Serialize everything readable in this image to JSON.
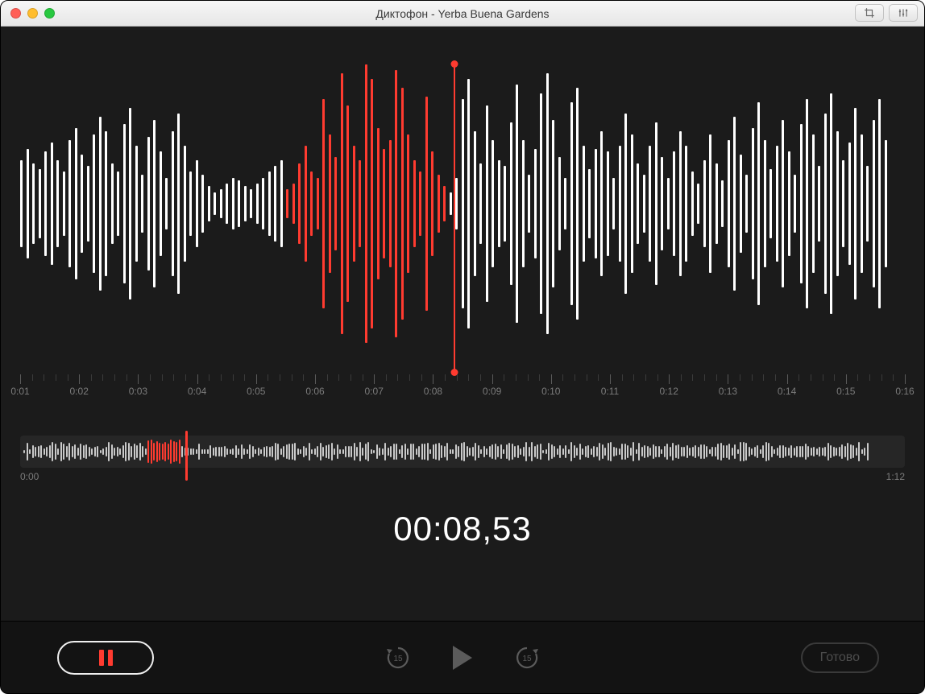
{
  "window": {
    "title": "Диктофон - Yerba Buena Gardens"
  },
  "toolbar": {
    "crop_icon": "crop-icon",
    "tune_icon": "equalizer-icon"
  },
  "timeline": {
    "labels": [
      "0:01",
      "0:02",
      "0:03",
      "0:04",
      "0:05",
      "0:06",
      "0:07",
      "0:08",
      "0:09",
      "0:10",
      "0:11",
      "0:12",
      "0:13",
      "0:14",
      "0:15",
      "0:16"
    ],
    "playhead_percent": 49.0
  },
  "overview": {
    "start": "0:00",
    "end": "1:12",
    "cursor_percent": 18.7
  },
  "time_display": "00:08,53",
  "controls": {
    "skip_back_label": "15",
    "skip_fwd_label": "15",
    "done_label": "Готово"
  },
  "waveform_main": {
    "bar_count": 144,
    "recording_start_index": 44,
    "recording_end_index": 71,
    "heights_percent": [
      30,
      38,
      28,
      24,
      36,
      42,
      30,
      22,
      44,
      52,
      34,
      26,
      48,
      60,
      50,
      28,
      22,
      55,
      66,
      40,
      20,
      46,
      58,
      36,
      18,
      50,
      62,
      40,
      22,
      30,
      20,
      12,
      8,
      10,
      14,
      18,
      16,
      12,
      10,
      14,
      18,
      22,
      26,
      30,
      10,
      14,
      28,
      40,
      22,
      18,
      72,
      48,
      32,
      90,
      68,
      40,
      30,
      96,
      86,
      52,
      38,
      44,
      92,
      80,
      48,
      30,
      22,
      74,
      36,
      20,
      12,
      8,
      18,
      72,
      86,
      50,
      28,
      68,
      44,
      30,
      26,
      56,
      82,
      44,
      20,
      38,
      76,
      90,
      58,
      32,
      18,
      70,
      80,
      40,
      24,
      38,
      50,
      36,
      18,
      40,
      62,
      48,
      28,
      20,
      40,
      56,
      32,
      18,
      36,
      50,
      40,
      22,
      14,
      30,
      48,
      28,
      16,
      44,
      60,
      34,
      20,
      52,
      70,
      44,
      24,
      40,
      58,
      36,
      20,
      55,
      72,
      48,
      26,
      62,
      76,
      50,
      30,
      42,
      66,
      48,
      26,
      58,
      72,
      44
    ]
  },
  "waveform_overview": {
    "bar_count": 300,
    "recording_start_index": 44,
    "recording_end_index": 56
  }
}
